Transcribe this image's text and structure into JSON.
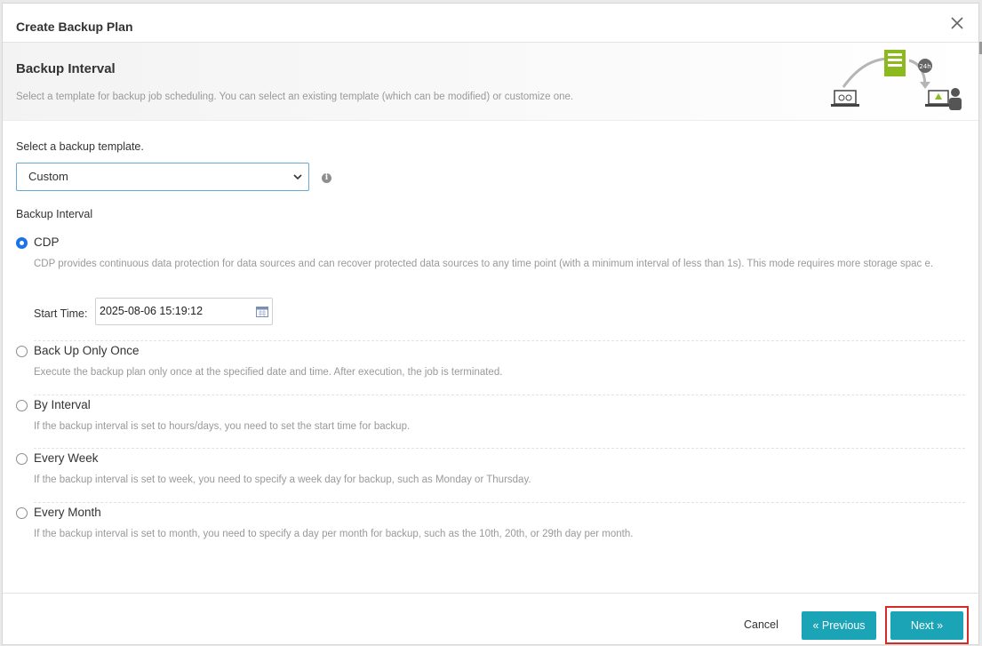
{
  "dialog": {
    "title": "Create Backup Plan",
    "close_icon": "close-icon"
  },
  "banner": {
    "title": "Backup Interval",
    "description": "Select a template for backup job scheduling. You can select an existing template (which can be modified) or customize one.",
    "badge": "24h",
    "accent_color": "#8cba1e"
  },
  "template": {
    "label": "Select a backup template.",
    "selected": "Custom"
  },
  "interval": {
    "label": "Backup Interval",
    "options": [
      {
        "label": "CDP",
        "description": "CDP provides continuous data protection for data sources and can recover protected data sources to any time point (with a minimum interval of less than 1s). This mode requires more storage spac e.",
        "checked": true
      },
      {
        "label": "Back Up Only Once",
        "description": "Execute the backup plan only once at the specified date and time. After execution, the job is terminated.",
        "checked": false
      },
      {
        "label": "By Interval",
        "description": "If the backup interval is set to hours/days, you need to set the start time for backup.",
        "checked": false
      },
      {
        "label": "Every Week",
        "description": "If the backup interval is set to week, you need to specify a week day for backup, such as Monday or Thursday.",
        "checked": false
      },
      {
        "label": "Every Month",
        "description": "If the backup interval is set to month, you need to specify a day per month for backup, such as the 10th, 20th, or 29th day per month.",
        "checked": false
      }
    ]
  },
  "start_time": {
    "label": "Start Time:",
    "value": "2025-08-06 15:19:12"
  },
  "footer": {
    "cancel": "Cancel",
    "previous": "« Previous",
    "next": "Next »",
    "button_color": "#1ba3b6",
    "highlight_color": "#d62b2b"
  }
}
